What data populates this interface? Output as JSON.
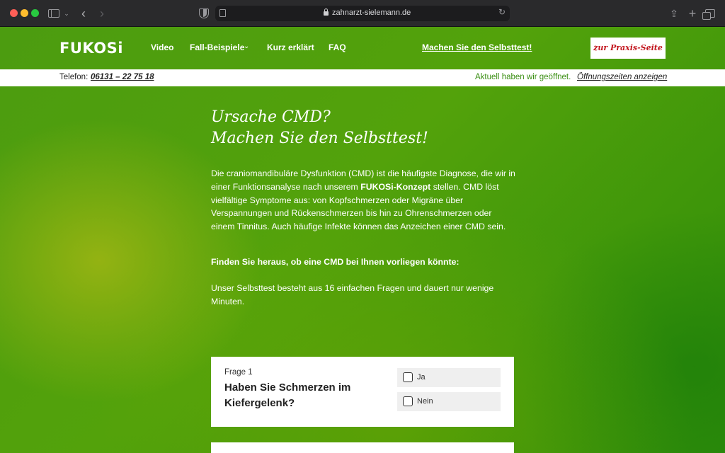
{
  "browser": {
    "url": "zahnarzt-sielemann.de"
  },
  "nav": {
    "logo": "FUKOSi",
    "video": "Video",
    "fall_beispiele": "Fall-Beispiele",
    "kurz_erklaert": "Kurz erklärt",
    "faq": "FAQ",
    "selbsttest": "Machen Sie den Selbsttest!",
    "praxis_button": "zur Praxis-Seite"
  },
  "infobar": {
    "telefon_label": "Telefon:",
    "telefon_number": "06131 – 22 75 18",
    "open_status": "Aktuell haben wir geöffnet.",
    "open_link": "Öffnungszeiten anzeigen"
  },
  "main": {
    "heading_line1": "Ursache CMD?",
    "heading_line2": "Machen Sie den Selbsttest!",
    "intro_part1": "Die craniomandibuläre Dysfunktion (CMD) ist die häufigste Diagnose, die wir in einer Funktionsanalyse nach unserem ",
    "intro_bold": "FUKOSi-Konzept",
    "intro_part2": " stellen. CMD löst vielfältige Symptome aus: von Kopfschmerzen oder Migräne über Verspannungen und Rückenschmerzen bis hin zu Ohrenschmerzen oder einem Tinnitus. Auch häufige Infekte können das Anzeichen einer CMD sein.",
    "find_out": "Finden Sie heraus, ob eine CMD bei Ihnen vorliegen könnte:",
    "duration": "Unser Selbsttest besteht aus 16 einfachen Fragen und dauert nur wenige Minuten."
  },
  "question1": {
    "label": "Frage 1",
    "text": "Haben Sie Schmerzen im Kiefergelenk?",
    "option_yes": "Ja",
    "option_no": "Nein"
  }
}
